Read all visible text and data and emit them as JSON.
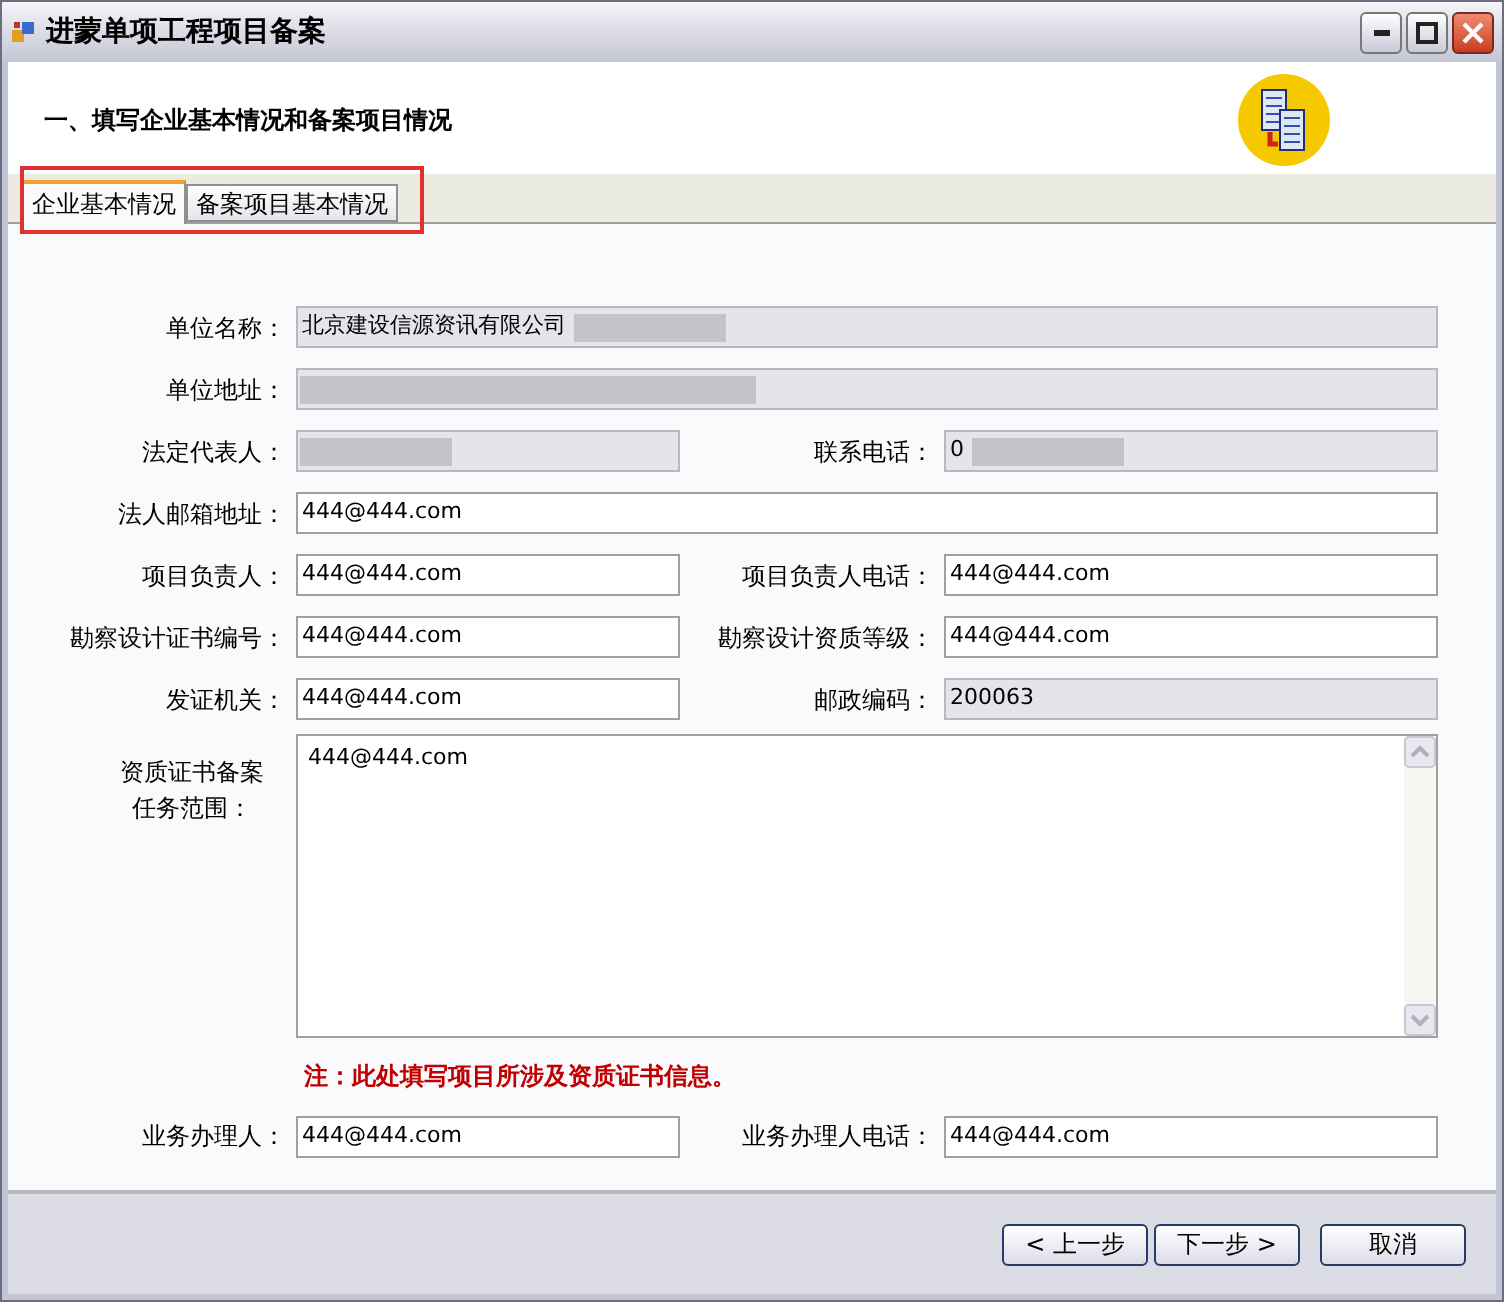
{
  "window": {
    "title": "进蒙单项工程项目备案"
  },
  "heading": "一、填写企业基本情况和备案项目情况",
  "tabs": [
    {
      "label": "企业基本情况",
      "selected": true
    },
    {
      "label": "备案项目基本情况",
      "selected": false
    }
  ],
  "tabs_highlighted": true,
  "form_rows": [
    {
      "fields": [
        {
          "label": "单位名称：",
          "value": "北京建设信源资讯有限公司",
          "readonly": true,
          "redacted": true
        }
      ]
    },
    {
      "fields": [
        {
          "label": "单位地址：",
          "readonly": true,
          "redacted": true
        }
      ]
    },
    {
      "fields": [
        {
          "label": "法定代表人：",
          "readonly": true,
          "redacted": true
        },
        {
          "label": "联系电话：",
          "value": "0",
          "readonly": true,
          "redacted": true
        }
      ]
    },
    {
      "fields": [
        {
          "label": "法人邮箱地址：",
          "value": "444@444.com",
          "readonly": false,
          "redacted": false
        }
      ]
    },
    {
      "fields": [
        {
          "label": "项目负责人：",
          "value": "444@444.com",
          "readonly": false,
          "redacted": false
        },
        {
          "label": "项目负责人电话：",
          "value": "444@444.com",
          "readonly": false,
          "redacted": false
        }
      ]
    },
    {
      "fields": [
        {
          "label": "勘察设计证书编号：",
          "value": "444@444.com",
          "readonly": false,
          "redacted": false
        },
        {
          "label": "勘察设计资质等级：",
          "value": "444@444.com",
          "readonly": false,
          "redacted": false
        }
      ]
    },
    {
      "fields": [
        {
          "label": "发证机关：",
          "value": "444@444.com",
          "readonly": false,
          "redacted": false
        },
        {
          "label": "邮政编码：",
          "value": "200063",
          "readonly": true,
          "redacted": false
        }
      ]
    }
  ],
  "scope": {
    "label_lines": [
      "资质证书备案",
      "任务范围："
    ],
    "value": "444@444.com"
  },
  "note": "注：此处填写项目所涉及资质证书信息。",
  "handler_row": {
    "fields": [
      {
        "label": "业务办理人：",
        "value": "444@444.com",
        "readonly": false,
        "redacted": false
      },
      {
        "label": "业务办理人电话：",
        "value": "444@444.com",
        "readonly": false,
        "redacted": false
      }
    ]
  },
  "buttons": [
    "< 上一步",
    "下一步 >",
    "取消"
  ]
}
